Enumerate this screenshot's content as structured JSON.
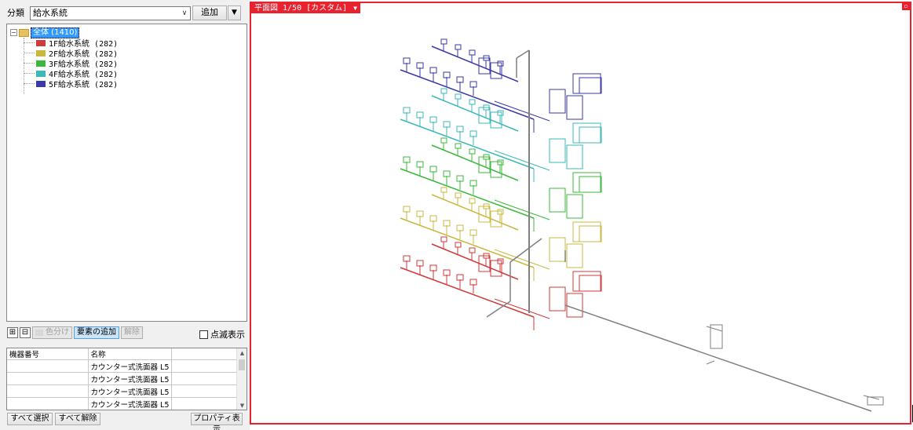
{
  "left_panel": {
    "category_label": "分類",
    "category_value": "給水系統",
    "add_button": "追加",
    "tree": {
      "root_label": "全体 (1410)",
      "items": [
        {
          "label": "1F給水系統 (282)",
          "color": "#d03a3a"
        },
        {
          "label": "2F給水系統 (282)",
          "color": "#c8b840"
        },
        {
          "label": "3F給水系統 (282)",
          "color": "#3cb83c"
        },
        {
          "label": "4F給水系統 (282)",
          "color": "#3cb8b8"
        },
        {
          "label": "5F給水系統 (282)",
          "color": "#3a3aa8"
        }
      ]
    },
    "toolbar": {
      "color_split": "色分け",
      "add_element": "要素の追加",
      "release": "解除",
      "blink_display": "点滅表示"
    },
    "grid": {
      "headers": [
        "機器番号",
        "名称"
      ],
      "rows": [
        [
          "",
          "カウンター式洗面器 L5"
        ],
        [
          "",
          "カウンター式洗面器 L5"
        ],
        [
          "",
          "カウンター式洗面器 L5"
        ],
        [
          "",
          "カウンター式洗面器 L5"
        ]
      ]
    },
    "bottom": {
      "select_all": "すべて選択",
      "deselect_all": "すべて解除",
      "properties": "プロパティ表示"
    }
  },
  "viewport": {
    "title": "平面図 1/50 [カスタム]",
    "border_color": "#e8232f"
  }
}
